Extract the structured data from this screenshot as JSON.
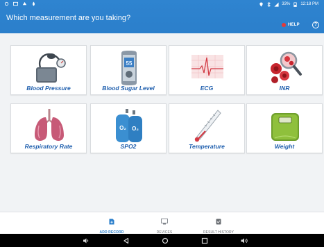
{
  "status_bar": {
    "battery_text": "33%",
    "time": "12:18 PM"
  },
  "header": {
    "title": "Which measurement are you taking?",
    "help_label": "HELP",
    "info_icon": "info-icon"
  },
  "tiles": [
    {
      "label": "Blood Pressure",
      "icon": "blood-pressure-monitor-icon"
    },
    {
      "label": "Blood Sugar Level",
      "icon": "glucometer-icon"
    },
    {
      "label": "ECG",
      "icon": "ecg-icon"
    },
    {
      "label": "INR",
      "icon": "blood-cells-magnifier-icon"
    },
    {
      "label": "Respiratory Rate",
      "icon": "lungs-icon"
    },
    {
      "label": "SPO2",
      "icon": "oxygen-cylinders-icon"
    },
    {
      "label": "Temperature",
      "icon": "thermometer-icon"
    },
    {
      "label": "Weight",
      "icon": "scale-icon"
    }
  ],
  "bottom_nav": [
    {
      "label": "ADD RECORD",
      "icon": "add-record-icon",
      "active": true
    },
    {
      "label": "DEVICES",
      "icon": "devices-icon",
      "active": false
    },
    {
      "label": "RESULT HISTORY",
      "icon": "result-history-icon",
      "active": false
    }
  ],
  "colors": {
    "header_blue": "#2b7fcb",
    "tile_label": "#1f5fae",
    "help_red": "#e23a3a"
  }
}
